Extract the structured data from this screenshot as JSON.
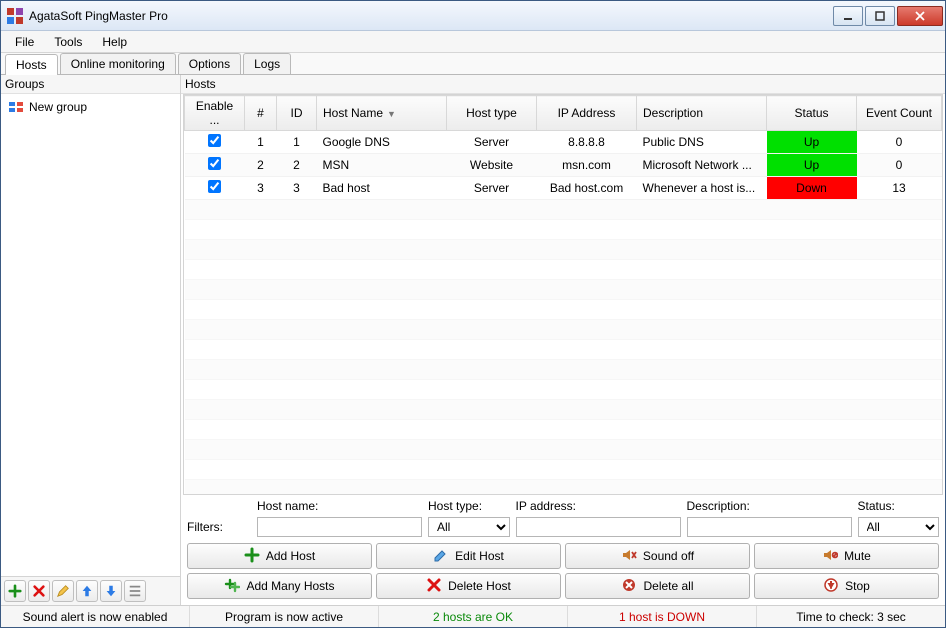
{
  "window": {
    "title": "AgataSoft PingMaster Pro"
  },
  "menu": {
    "file": "File",
    "tools": "Tools",
    "help": "Help"
  },
  "tabs": {
    "hosts": "Hosts",
    "online": "Online monitoring",
    "options": "Options",
    "logs": "Logs"
  },
  "panels": {
    "groups": "Groups",
    "hosts": "Hosts"
  },
  "tree": {
    "root": "New group"
  },
  "grid": {
    "headers": {
      "enable": "Enable ...",
      "num": "#",
      "id": "ID",
      "name": "Host Name",
      "type": "Host type",
      "ip": "IP Address",
      "desc": "Description",
      "status": "Status",
      "events": "Event Count"
    },
    "rows": [
      {
        "enabled": true,
        "num": "1",
        "id": "1",
        "name": "Google DNS",
        "type": "Server",
        "ip": "8.8.8.8",
        "desc": "Public DNS",
        "status": "Up",
        "statusClass": "status-up",
        "events": "0"
      },
      {
        "enabled": true,
        "num": "2",
        "id": "2",
        "name": "MSN",
        "type": "Website",
        "ip": "msn.com",
        "desc": "Microsoft Network ...",
        "status": "Up",
        "statusClass": "status-up",
        "events": "0"
      },
      {
        "enabled": true,
        "num": "3",
        "id": "3",
        "name": "Bad host",
        "type": "Server",
        "ip": "Bad host.com",
        "desc": "Whenever a host is...",
        "status": "Down",
        "statusClass": "status-down",
        "events": "13"
      }
    ]
  },
  "filters": {
    "label": "Filters:",
    "hostname_label": "Host name:",
    "hosttype_label": "Host type:",
    "ip_label": "IP address:",
    "desc_label": "Description:",
    "status_label": "Status:",
    "hostname": "",
    "hosttype": "All",
    "ip": "",
    "desc": "",
    "status": "All"
  },
  "actions": {
    "add_host": "Add Host",
    "edit_host": "Edit Host",
    "sound_off": "Sound off",
    "mute": "Mute",
    "add_many": "Add Many Hosts",
    "delete_host": "Delete Host",
    "delete_all": "Delete all",
    "stop": "Stop"
  },
  "statusbar": {
    "sound": "Sound alert is now enabled",
    "program": "Program is now active",
    "ok": "2 hosts are OK",
    "down": "1 host is DOWN",
    "timer": "Time to check: 3 sec"
  }
}
